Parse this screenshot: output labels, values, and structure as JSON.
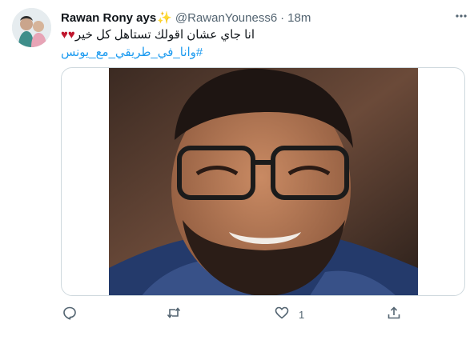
{
  "tweet": {
    "author_name": "Rawan Rony ays",
    "author_emoji": "✨",
    "handle": "@RawanYouness6",
    "separator": "·",
    "timestamp": "18m",
    "text": "انا جاي عشان اقولك تستاهل كل خير",
    "text_emoji": "♥♥",
    "hashtag": "#وانا_في_طريقي_مع_يونس",
    "like_count": "1"
  },
  "colors": {
    "link": "#1d9bf0",
    "secondary_text": "#536471",
    "heart_emoji": "#c0162e"
  },
  "icons": [
    "more-icon",
    "reply-icon",
    "retweet-icon",
    "like-icon",
    "share-icon"
  ]
}
